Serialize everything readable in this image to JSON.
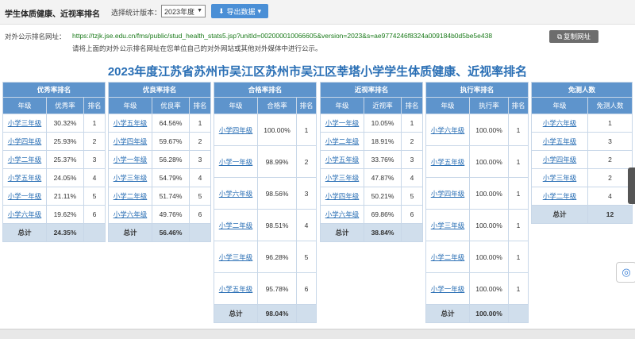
{
  "header": {
    "title": "学生体质健康、近视率排名",
    "year_label": "选择统计版本：",
    "year_value": "2023年度",
    "export_label": "导出数据"
  },
  "public_url": {
    "label": "对外公示排名网址：",
    "url": "https://tzjk.jse.edu.cn/fms/public/stud_health_stats5.jsp?unitId=002000010066605&version=2023&s=ae9774246f8324a009184b0d5be5e438",
    "copy_label": "复制网址",
    "hint": "请将上面的对外公示排名网址在您单位自己的对外网站或其他对外媒体中进行公示。"
  },
  "main_title": "2023年度江苏省苏州市吴江区苏州市吴江区莘塔小学学生体质健康、近视率排名",
  "tables": [
    {
      "caption": "优秀率排名",
      "columns": [
        "年级",
        "优秀率",
        "排名"
      ],
      "rows": [
        {
          "grade": "小学三年级",
          "value": "30.32%",
          "rank": "1"
        },
        {
          "grade": "小学四年级",
          "value": "25.93%",
          "rank": "2"
        },
        {
          "grade": "小学二年级",
          "value": "25.37%",
          "rank": "3"
        },
        {
          "grade": "小学五年级",
          "value": "24.05%",
          "rank": "4"
        },
        {
          "grade": "小学一年级",
          "value": "21.11%",
          "rank": "5"
        },
        {
          "grade": "小学六年级",
          "value": "19.62%",
          "rank": "6"
        }
      ],
      "total_label": "总计",
      "total_value": "24.35%"
    },
    {
      "caption": "优良率排名",
      "columns": [
        "年级",
        "优良率",
        "排名"
      ],
      "rows": [
        {
          "grade": "小学五年级",
          "value": "64.56%",
          "rank": "1"
        },
        {
          "grade": "小学四年级",
          "value": "59.67%",
          "rank": "2"
        },
        {
          "grade": "小学一年级",
          "value": "56.28%",
          "rank": "3"
        },
        {
          "grade": "小学三年级",
          "value": "54.79%",
          "rank": "4"
        },
        {
          "grade": "小学二年级",
          "value": "51.74%",
          "rank": "5"
        },
        {
          "grade": "小学六年级",
          "value": "49.76%",
          "rank": "6"
        }
      ],
      "total_label": "总计",
      "total_value": "56.46%"
    },
    {
      "caption": "合格率排名",
      "columns": [
        "年级",
        "合格率",
        "排名"
      ],
      "rows": [
        {
          "grade": "小学四年级",
          "value": "100.00%",
          "rank": "1"
        },
        {
          "grade": "小学一年级",
          "value": "98.99%",
          "rank": "2"
        },
        {
          "grade": "小学六年级",
          "value": "98.56%",
          "rank": "3"
        },
        {
          "grade": "小学二年级",
          "value": "98.51%",
          "rank": "4"
        },
        {
          "grade": "小学三年级",
          "value": "96.28%",
          "rank": "5"
        },
        {
          "grade": "小学五年级",
          "value": "95.78%",
          "rank": "6"
        }
      ],
      "total_label": "总计",
      "total_value": "98.04%"
    },
    {
      "caption": "近视率排名",
      "columns": [
        "年级",
        "近视率",
        "排名"
      ],
      "rows": [
        {
          "grade": "小学一年级",
          "value": "10.05%",
          "rank": "1"
        },
        {
          "grade": "小学二年级",
          "value": "18.91%",
          "rank": "2"
        },
        {
          "grade": "小学五年级",
          "value": "33.76%",
          "rank": "3"
        },
        {
          "grade": "小学三年级",
          "value": "47.87%",
          "rank": "4"
        },
        {
          "grade": "小学四年级",
          "value": "50.21%",
          "rank": "5"
        },
        {
          "grade": "小学六年级",
          "value": "69.86%",
          "rank": "6"
        }
      ],
      "total_label": "总计",
      "total_value": "38.84%"
    },
    {
      "caption": "执行率排名",
      "columns": [
        "年级",
        "执行率",
        "排名"
      ],
      "rows": [
        {
          "grade": "小学六年级",
          "value": "100.00%",
          "rank": "1"
        },
        {
          "grade": "小学五年级",
          "value": "100.00%",
          "rank": "1"
        },
        {
          "grade": "小学四年级",
          "value": "100.00%",
          "rank": "1"
        },
        {
          "grade": "小学三年级",
          "value": "100.00%",
          "rank": "1"
        },
        {
          "grade": "小学二年级",
          "value": "100.00%",
          "rank": "1"
        },
        {
          "grade": "小学一年级",
          "value": "100.00%",
          "rank": "1"
        }
      ],
      "total_label": "总计",
      "total_value": "100.00%"
    },
    {
      "caption": "免测人数",
      "columns": [
        "年级",
        "免测人数"
      ],
      "rows": [
        {
          "grade": "小学六年级",
          "value": "1"
        },
        {
          "grade": "小学五年级",
          "value": "3"
        },
        {
          "grade": "小学四年级",
          "value": "2"
        },
        {
          "grade": "小学三年级",
          "value": "2"
        },
        {
          "grade": "小学二年级",
          "value": "4"
        }
      ],
      "total_label": "总计",
      "total_value": "12"
    }
  ]
}
